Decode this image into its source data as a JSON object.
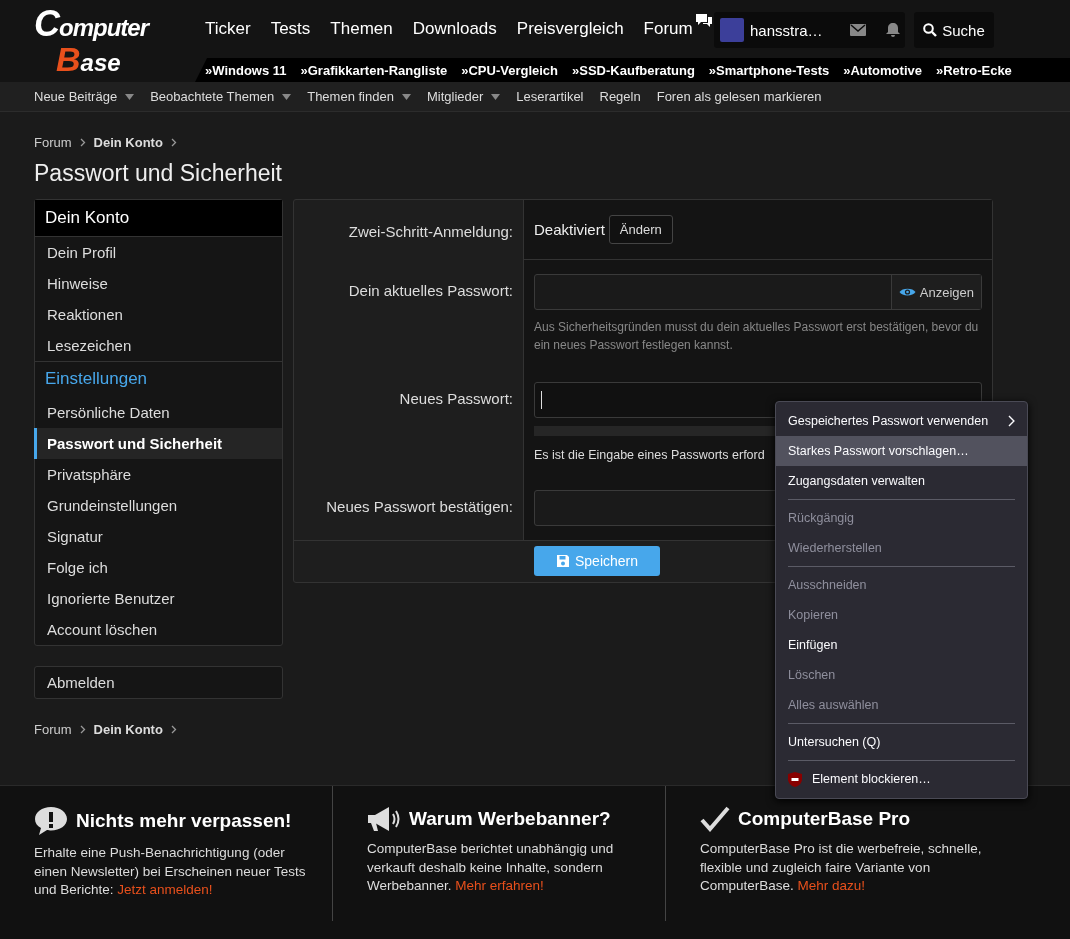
{
  "header": {
    "logo_top": "Computer",
    "logo_bottom": "Base",
    "nav": [
      {
        "label": "Ticker",
        "icon": false
      },
      {
        "label": "Tests",
        "icon": false
      },
      {
        "label": "Themen",
        "icon": false
      },
      {
        "label": "Downloads",
        "icon": false
      },
      {
        "label": "Preisvergleich",
        "icon": false
      },
      {
        "label": "Forum",
        "icon": true
      }
    ],
    "user_name": "hansstra…",
    "search_button": "Suche",
    "quicklinks": [
      "»Windows 11",
      "»Grafikkarten-Rangliste",
      "»CPU-Vergleich",
      "»SSD-Kaufberatung",
      "»Smartphone-Tests",
      "»Automotive",
      "»Retro-Ecke"
    ]
  },
  "subnav": [
    {
      "label": "Neue Beiträge",
      "dropdown": true
    },
    {
      "label": "Beobachtete Themen",
      "dropdown": true
    },
    {
      "label": "Themen finden",
      "dropdown": true
    },
    {
      "label": "Mitglieder",
      "dropdown": true
    },
    {
      "label": "Leserartikel",
      "dropdown": false
    },
    {
      "label": "Regeln",
      "dropdown": false
    },
    {
      "label": "Foren als gelesen markieren",
      "dropdown": false
    }
  ],
  "breadcrumbs_top": [
    {
      "label": "Forum",
      "current": false
    },
    {
      "label": "Dein Konto",
      "current": true
    }
  ],
  "breadcrumbs_bottom": [
    {
      "label": "Forum",
      "current": false
    },
    {
      "label": "Dein Konto",
      "current": true
    }
  ],
  "page_title": "Passwort und Sicherheit",
  "sidebar": {
    "sections": [
      {
        "title": "Dein Konto",
        "kind": "header",
        "items": [
          {
            "label": "Dein Profil",
            "selected": false
          },
          {
            "label": "Hinweise",
            "selected": false
          },
          {
            "label": "Reaktionen",
            "selected": false
          },
          {
            "label": "Lesezeichen",
            "selected": false
          }
        ]
      },
      {
        "title": "Einstellungen",
        "kind": "accent",
        "items": [
          {
            "label": "Persönliche Daten",
            "selected": false
          },
          {
            "label": "Passwort und Sicherheit",
            "selected": true
          },
          {
            "label": "Privatsphäre",
            "selected": false
          },
          {
            "label": "Grundeinstellungen",
            "selected": false
          },
          {
            "label": "Signatur",
            "selected": false
          },
          {
            "label": "Folge ich",
            "selected": false
          },
          {
            "label": "Ignorierte Benutzer",
            "selected": false
          },
          {
            "label": "Account löschen",
            "selected": false
          }
        ]
      }
    ],
    "logout": "Abmelden"
  },
  "form": {
    "rows": [
      {
        "kind": "status",
        "label": "Zwei-Schritt-Anmeldung:",
        "value": "Deaktiviert",
        "button": "Ändern"
      },
      {
        "kind": "password",
        "label": "Dein aktuelles Passwort:",
        "focused": false,
        "show_button": "Anzeigen",
        "hint": "Aus Sicherheitsgründen musst du dein aktuelles Passwort erst bestätigen, bevor du ein neues Passwort festlegen kannst."
      },
      {
        "kind": "password",
        "label": "Neues Passwort:",
        "focused": true,
        "strength": {
          "level": 0
        },
        "message": "Es ist die Eingabe eines Passworts erford"
      },
      {
        "kind": "password",
        "label": "Neues Passwort bestätigen:",
        "focused": false
      }
    ],
    "save_button": "Speichern"
  },
  "context_menu": [
    {
      "kind": "item",
      "label": "Gespeichertes Passwort verwenden",
      "disabled": false,
      "selected": false,
      "submenu": true
    },
    {
      "kind": "item",
      "label": "Starkes Passwort vorschlagen…",
      "disabled": false,
      "selected": true,
      "submenu": false
    },
    {
      "kind": "item",
      "label": "Zugangsdaten verwalten",
      "disabled": false,
      "selected": false,
      "submenu": false
    },
    {
      "kind": "separator"
    },
    {
      "kind": "item",
      "label": "Rückgängig",
      "disabled": true,
      "selected": false,
      "submenu": false
    },
    {
      "kind": "item",
      "label": "Wiederherstellen",
      "disabled": true,
      "selected": false,
      "submenu": false
    },
    {
      "kind": "separator"
    },
    {
      "kind": "item",
      "label": "Ausschneiden",
      "disabled": true,
      "selected": false,
      "submenu": false
    },
    {
      "kind": "item",
      "label": "Kopieren",
      "disabled": true,
      "selected": false,
      "submenu": false
    },
    {
      "kind": "item",
      "label": "Einfügen",
      "disabled": false,
      "selected": false,
      "submenu": false
    },
    {
      "kind": "item",
      "label": "Löschen",
      "disabled": true,
      "selected": false,
      "submenu": false
    },
    {
      "kind": "item",
      "label": "Alles auswählen",
      "disabled": true,
      "selected": false,
      "submenu": false
    },
    {
      "kind": "separator"
    },
    {
      "kind": "item",
      "label": "Untersuchen (Q)",
      "disabled": false,
      "selected": false,
      "submenu": false
    },
    {
      "kind": "separator"
    },
    {
      "kind": "extension",
      "label": "Element blockieren…",
      "disabled": false,
      "selected": false,
      "submenu": false
    }
  ],
  "footer": [
    {
      "kind": "alert",
      "title": "Nichts mehr verpassen!",
      "text": "Erhalte eine Push-Benachrichtigung (oder einen Newsletter) bei Erscheinen neuer Tests und Berichte: ",
      "link": "Jetzt anmelden!"
    },
    {
      "kind": "megaphone",
      "title": "Warum Werbebanner?",
      "text": "ComputerBase berichtet unabhängig und verkauft deshalb keine Inhalte, sondern Werbebanner. ",
      "link": "Mehr erfahren!"
    },
    {
      "kind": "check",
      "title": "ComputerBase Pro",
      "text": "ComputerBase Pro ist die werbefreie, schnelle, flexible und zugleich faire Variante von ComputerBase. ",
      "link": "Mehr dazu!"
    }
  ]
}
